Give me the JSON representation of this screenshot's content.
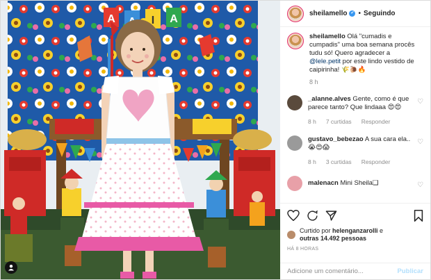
{
  "post": {
    "username": "sheilamello",
    "follow_status": "Seguindo",
    "separator": "•",
    "verified_mark": "✔"
  },
  "caption": {
    "username": "sheilamello",
    "text_before": " Olá \"cumadis e cumpadis\" uma boa semana procês tudu só! Quero agradecer a ",
    "mention": "@lele.petit",
    "text_after": " por este lindo vestido de caipirinha! 🌾🐌🔥",
    "time": "8 h"
  },
  "comments": [
    {
      "username": "_alanne.alves",
      "text": " Gente, como é que parece tanto? Que lindaaa 😍😍",
      "time": "8 h",
      "likes": "7 curtidas",
      "reply": "Responder",
      "avatar_color": "#5a4a3c"
    },
    {
      "username": "gustavo_bebezao",
      "text": " A sua cara ela..",
      "emoji": "😭😍😱",
      "time": "8 h",
      "likes": "3 curtidas",
      "reply": "Responder",
      "avatar_color": "#9a9a9a"
    },
    {
      "username": "malenacn",
      "text": " Mini Sheila❑",
      "avatar_color": "#e8a0a8"
    }
  ],
  "actions": {
    "liked_by_prefix": "Curtido por ",
    "liked_by_user": "helenganzarolli",
    "liked_by_suffix": " e",
    "others": "outras 14.492 pessoas",
    "ago": "HÁ 8 HORAS"
  },
  "composer": {
    "placeholder": "Adicione um comentário...",
    "publish": "Publicar"
  },
  "photo": {
    "banner_letters": [
      "A",
      "A",
      "I",
      "A"
    ]
  }
}
